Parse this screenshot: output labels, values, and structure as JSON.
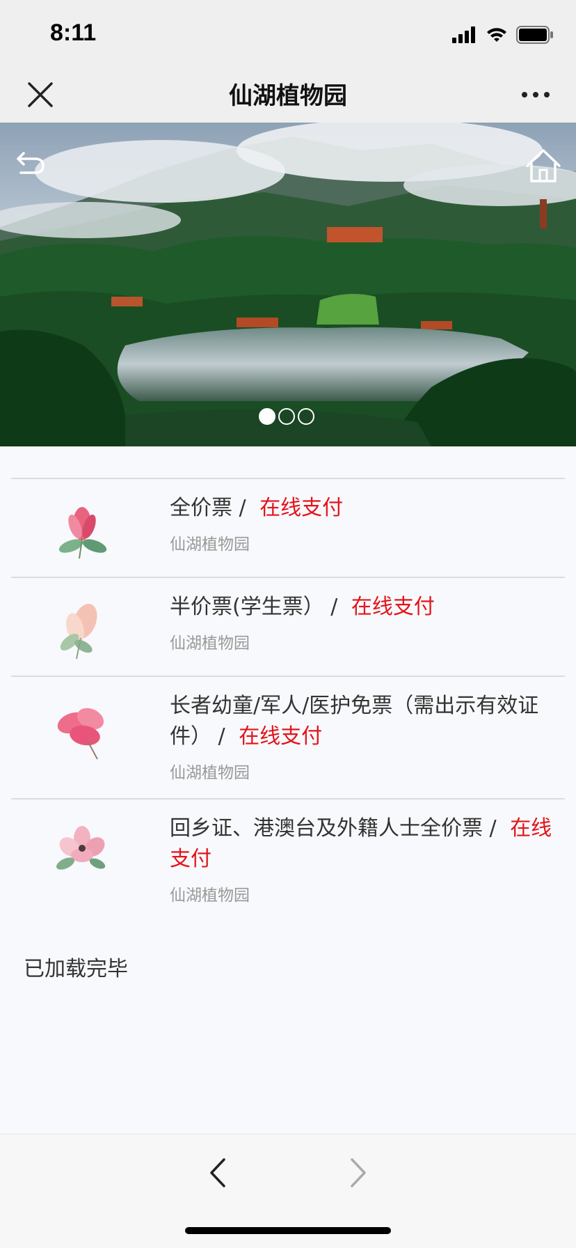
{
  "status_bar": {
    "time": "8:11"
  },
  "nav": {
    "title": "仙湖植物园",
    "close_icon": "close-icon",
    "more_icon": "more-icon"
  },
  "banner": {
    "image": "mountain-lake-landscape",
    "back_icon": "back-icon",
    "home_icon": "home-icon",
    "dots": {
      "count": 3,
      "active_index": 0
    }
  },
  "tickets": [
    {
      "title": "全价票 / ",
      "pay": "在线支付",
      "subtitle": "仙湖植物园",
      "icon": "flower-icon"
    },
    {
      "title": "半价票(学生票） / ",
      "pay": "在线支付",
      "subtitle": "仙湖植物园",
      "icon": "flower-icon"
    },
    {
      "title": "长者幼童/军人/医护免票（需出示有效证件） / ",
      "pay": "在线支付",
      "subtitle": "仙湖植物园",
      "icon": "flower-icon"
    },
    {
      "title": "回乡证、港澳台及外籍人士全价票 / ",
      "pay": "在线支付",
      "subtitle": "仙湖植物园",
      "icon": "flower-icon"
    }
  ],
  "footer": {
    "loaded_text": "已加载完毕"
  },
  "toolbar": {
    "prev_icon": "chevron-left-icon",
    "next_icon": "chevron-right-icon"
  },
  "colors": {
    "accent_red": "#e3141b",
    "nav_bg": "#efefef",
    "page_bg": "#f8f9fc"
  }
}
